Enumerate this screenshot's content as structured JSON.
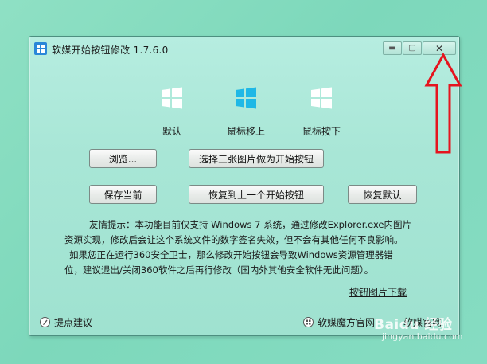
{
  "window": {
    "title": "软媒开始按钮修改 1.7.6.0",
    "controls": {
      "minimize": "▬",
      "maximize": "▢",
      "close": "✕"
    }
  },
  "logos": [
    {
      "label": "默认",
      "color": "#ffffff"
    },
    {
      "label": "鼠标移上",
      "color": "#1fb8e6"
    },
    {
      "label": "鼠标按下",
      "color": "#ffffff"
    }
  ],
  "buttons": {
    "browse": "浏览...",
    "select_three": "选择三张图片做为开始按钮",
    "save_current": "保存当前",
    "restore_previous": "恢复到上一个开始按钮",
    "restore_default": "恢复默认"
  },
  "hint": {
    "line1": "友情提示：本功能目前仅支持 Windows 7 系统，通过修改Explorer.exe内图片",
    "line2": "资源实现，修改后会让这个系统文件的数字签名失效，但不会有其他任何不良影响。",
    "line3": "如果您正在运行360安全卫士，那么修改开始按钮会导致Windows资源管理器错",
    "line4": "位，建议退出/关闭360软件之后再行修改（国内外其他安全软件无此问题）。"
  },
  "links": {
    "download": "按钮图片下载",
    "feedback": "提点建议",
    "official": "软媒魔方官网",
    "official2": "软媒官网"
  },
  "watermark": {
    "brand": "Baidu 经验",
    "url": "jingyan.baidu.com"
  }
}
